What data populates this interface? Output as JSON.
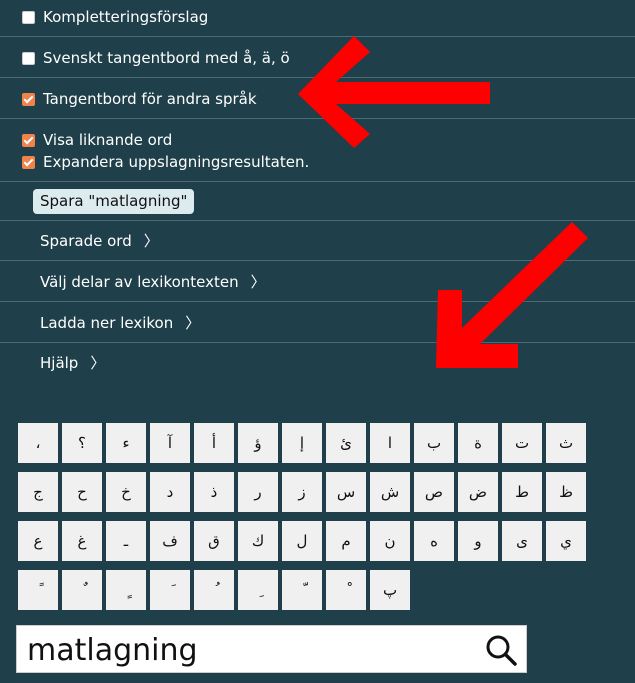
{
  "settings": {
    "options": [
      {
        "label": "Kompletteringsförslag",
        "checked": false
      },
      {
        "label": "Svenskt tangentbord med å, ä, ö",
        "checked": false
      },
      {
        "label": "Tangentbord för andra språk",
        "checked": true
      },
      {
        "label": "Visa liknande ord",
        "checked": true
      },
      {
        "label": "Expandera uppslagningsresultaten.",
        "checked": true
      }
    ],
    "save_button": "Spara \"matlagning\"",
    "menu": [
      {
        "label": "Sparade ord",
        "chevron": "〉"
      },
      {
        "label": "Välj delar av lexikontexten",
        "chevron": "〉"
      },
      {
        "label": "Ladda ner lexikon",
        "chevron": "〉"
      },
      {
        "label": "Hjälp",
        "chevron": "〉"
      }
    ]
  },
  "keyboard": {
    "rows": [
      [
        "،",
        "؟",
        "ء",
        "آ",
        "أ",
        "ؤ",
        "إ",
        "ئ",
        "ا",
        "ب",
        "ة",
        "ت",
        "ث"
      ],
      [
        "ج",
        "ح",
        "خ",
        "د",
        "ذ",
        "ر",
        "ز",
        "س",
        "ش",
        "ص",
        "ض",
        "ط",
        "ظ"
      ],
      [
        "ع",
        "غ",
        "ـ",
        "ف",
        "ق",
        "ك",
        "ل",
        "م",
        "ن",
        "ه",
        "و",
        "ى",
        "ي"
      ],
      [
        "ً",
        "ٌ",
        "ٍ",
        "َ",
        "ُ",
        "ِ",
        "ّ",
        "ْ",
        "پ"
      ]
    ]
  },
  "search": {
    "value": "matlagning",
    "icon": "search-icon"
  },
  "colors": {
    "background": "#1f3f4a",
    "checkbox_checked": "#f0834a",
    "annotation_arrow": "#ff0000"
  }
}
